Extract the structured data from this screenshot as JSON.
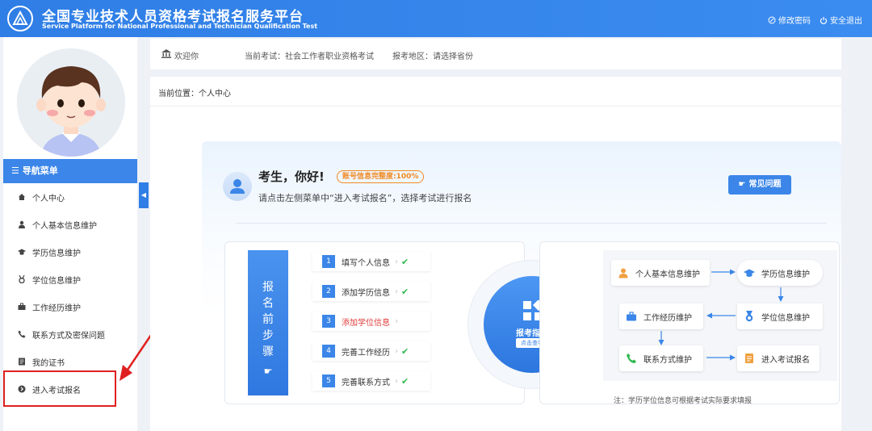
{
  "header": {
    "title_cn": "全国专业技术人员资格考试报名服务平台",
    "title_en": "Service Platform for National Professional and Technician Qualification Test",
    "change_password": "修改密码",
    "logout": "安全退出"
  },
  "sidebar": {
    "nav_title": "☰ 导航菜单",
    "items": [
      {
        "label": "个人中心",
        "icon": "home-icon"
      },
      {
        "label": "个人基本信息维护",
        "icon": "user-icon"
      },
      {
        "label": "学历信息维护",
        "icon": "graduation-cap-icon"
      },
      {
        "label": "学位信息维护",
        "icon": "medal-icon"
      },
      {
        "label": "工作经历维护",
        "icon": "briefcase-icon"
      },
      {
        "label": "联系方式及密保问题",
        "icon": "phone-icon"
      },
      {
        "label": "我的证书",
        "icon": "certificate-icon"
      },
      {
        "label": "进入考试报名",
        "icon": "arrow-circle-icon"
      }
    ],
    "collapse": "◀"
  },
  "infobar": {
    "welcome": "欢迎你",
    "current_exam": "当前考试：社会工作者职业资格考试",
    "region": "报考地区：请选择省份"
  },
  "breadcrumb": "当前位置：个人中心",
  "greeting": {
    "title": "考生，你好!",
    "badge": "账号信息完整度:100%",
    "subtitle": "请点击左侧菜单中“进入考试报名”，选择考试进行报名",
    "faq": "常见问题"
  },
  "steps": {
    "label_chars": [
      "报",
      "名",
      "前",
      "步",
      "骤"
    ],
    "items": [
      {
        "num": "1",
        "label": "填写个人信息",
        "done": true
      },
      {
        "num": "2",
        "label": "添加学历信息",
        "done": true
      },
      {
        "num": "3",
        "label": "添加学位信息",
        "done": false
      },
      {
        "num": "4",
        "label": "完善工作经历",
        "done": true
      },
      {
        "num": "5",
        "label": "完善联系方式",
        "done": true
      }
    ],
    "check": "✔",
    "chevron": "›"
  },
  "guide": {
    "title": "报考指南",
    "tag": "点击查看"
  },
  "flow": {
    "personal": "个人基本信息维护",
    "education": "学历信息维护",
    "work": "工作经历维护",
    "degree": "学位信息维护",
    "contact": "联系方式维护",
    "enter": "进入考试报名",
    "note": "注：学历学位信息可根据考试实际要求填报"
  },
  "colors": {
    "primary": "#3b86e8",
    "highlight_red": "#e02020",
    "step_alert": "#e23b3b",
    "check_green": "#2eb84f",
    "badge_orange": "#f08a24"
  }
}
